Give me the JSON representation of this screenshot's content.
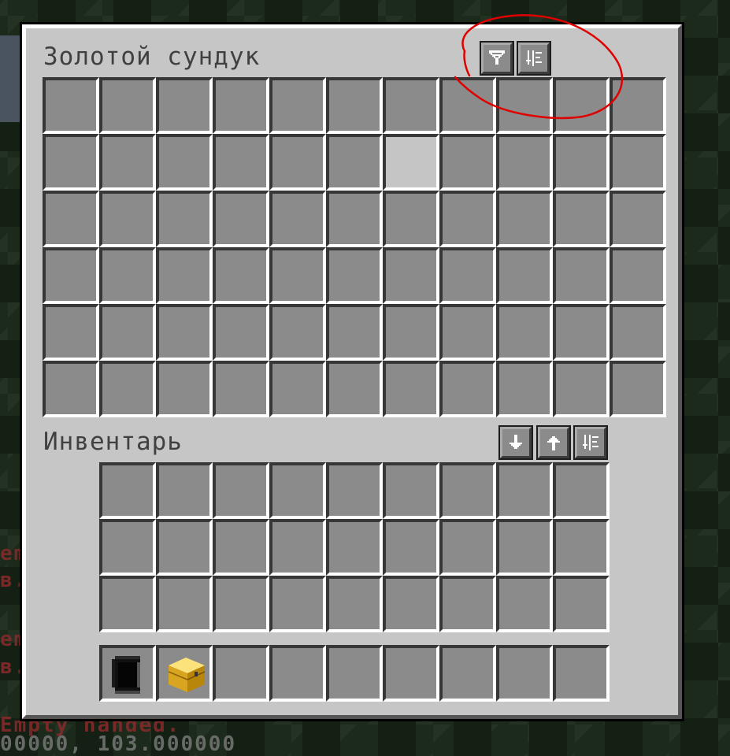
{
  "chest": {
    "title": "Золотой сундук",
    "columns": 11,
    "rows": 6,
    "highlighted_slot": 17,
    "buttons": [
      {
        "name": "filter-button",
        "icon": "funnel-icon"
      },
      {
        "name": "chest-sort-button",
        "icon": "sort-icon"
      }
    ]
  },
  "inventory": {
    "title": "Инвентарь",
    "columns": 9,
    "rows": 3,
    "buttons": [
      {
        "name": "deposit-button",
        "icon": "arrow-down-icon"
      },
      {
        "name": "withdraw-button",
        "icon": "arrow-up-icon"
      },
      {
        "name": "inventory-sort-button",
        "icon": "sort-icon"
      }
    ]
  },
  "hotbar": {
    "slots": 9,
    "items": [
      {
        "slot": 0,
        "icon": "black-shulker-box-icon"
      },
      {
        "slot": 1,
        "icon": "gold-chest-icon"
      }
    ]
  },
  "background_text": [
    "em",
    "в.",
    "em",
    "в.",
    "Empty handed.",
    "00000, 103.000000"
  ],
  "colors": {
    "panel": "#c6c6c6",
    "slot": "#8b8b8b",
    "title": "#404040",
    "annotation": "#e00000"
  }
}
